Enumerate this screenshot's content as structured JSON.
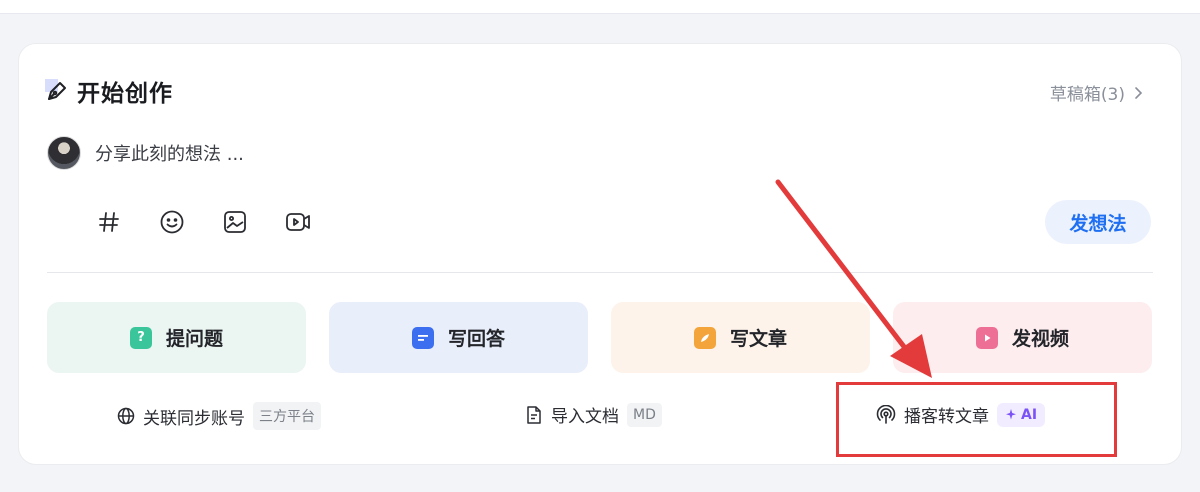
{
  "header": {
    "title": "开始创作",
    "drafts_label": "草稿箱(3)"
  },
  "composer": {
    "placeholder": "分享此刻的想法 ...",
    "post_button": "发想法"
  },
  "toolbar": {
    "icons": [
      "hashtag-icon",
      "emoji-icon",
      "image-icon",
      "video-icon"
    ]
  },
  "actions": [
    {
      "label": "提问题",
      "icon": "question-icon",
      "color": "#3bc59a"
    },
    {
      "label": "写回答",
      "icon": "answer-icon",
      "color": "#3b6ff0"
    },
    {
      "label": "写文章",
      "icon": "article-icon",
      "color": "#f3a43b"
    },
    {
      "label": "发视频",
      "icon": "video-icon",
      "color": "#ee6f95"
    }
  ],
  "bottom": {
    "link_account": {
      "label": "关联同步账号",
      "tag": "三方平台"
    },
    "import_doc": {
      "label": "导入文档",
      "tag": "MD"
    },
    "podcast": {
      "label": "播客转文章",
      "tag": "AI"
    }
  },
  "annotation_color": "#e33b3b"
}
